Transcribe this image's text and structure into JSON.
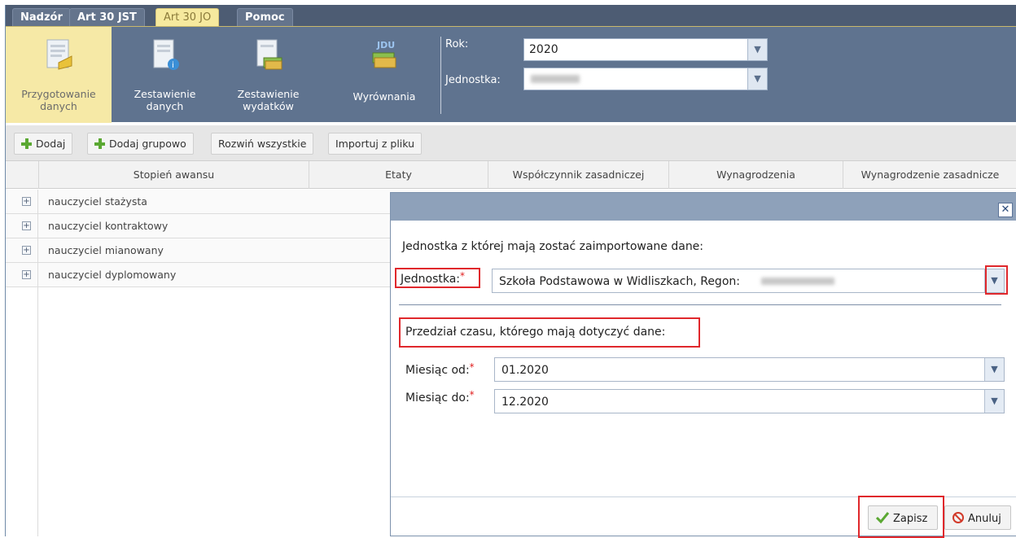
{
  "tabs": [
    "Nadzór",
    "Art 30 JST",
    "Art 30 JO",
    "Pomoc"
  ],
  "ribbon": {
    "buttons": [
      {
        "label": "Przygotowanie danych",
        "icon": "document-pencil-icon"
      },
      {
        "label": "Zestawienie danych",
        "icon": "document-info-icon"
      },
      {
        "label": "Zestawienie wydatków",
        "icon": "document-money-icon"
      },
      {
        "label": "Wyrównania",
        "icon": "jdu-money-icon",
        "badge": "JDU"
      }
    ],
    "rok_label": "Rok:",
    "rok_value": "2020",
    "jednostka_label": "Jednostka:"
  },
  "toolbar": {
    "dodaj": "Dodaj",
    "dodaj_grupowo": "Dodaj grupowo",
    "rozwin": "Rozwiń wszystkie",
    "importuj": "Importuj z pliku"
  },
  "grid": {
    "columns": [
      "Stopień awansu",
      "Etaty",
      "Współczynnik zasadniczej",
      "Wynagrodzenia",
      "Wynagrodzenie zasadnicze"
    ],
    "rows": [
      "nauczyciel stażysta",
      "nauczyciel kontraktowy",
      "nauczyciel mianowany",
      "nauczyciel dyplomowany"
    ]
  },
  "dialog": {
    "intro": "Jednostka z której mają zostać zaimportowane dane:",
    "jednostka_label": "Jednostka:",
    "jednostka_value": "Szkoła Podstawowa w Widliszkach, Regon:",
    "przedzial": "Przedział czasu, którego mają dotyczyć dane:",
    "od_label": "Miesiąc od:",
    "od_value": "01.2020",
    "do_label": "Miesiąc do:",
    "do_value": "12.2020",
    "required_mark": "*",
    "zapisz": "Zapisz",
    "anuluj": "Anuluj",
    "close": "✕"
  },
  "colors": {
    "highlight": "#e0282c",
    "active_tab": "#f6e99e",
    "ribbon": "#5f738f"
  }
}
